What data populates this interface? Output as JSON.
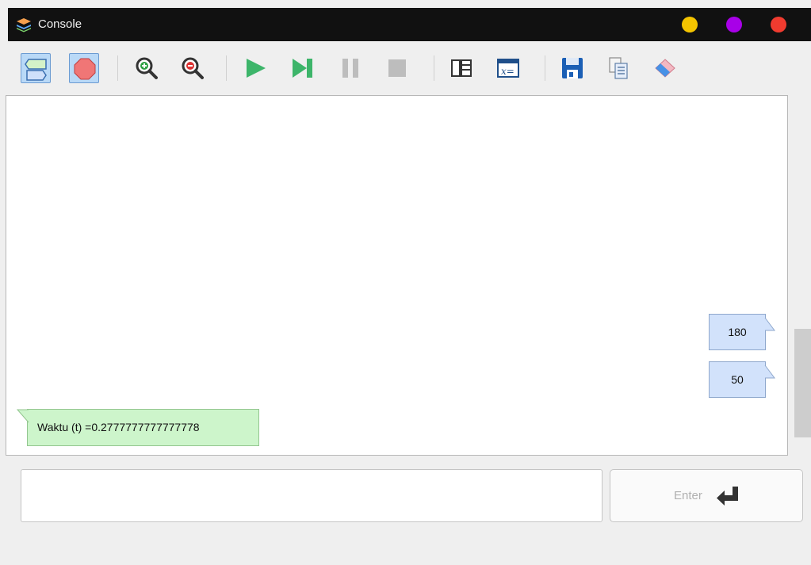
{
  "window": {
    "title": "Console",
    "controls": [
      {
        "name": "minimize",
        "color": "#f4c400"
      },
      {
        "name": "maximize",
        "color": "#a800e8"
      },
      {
        "name": "close",
        "color": "#f03b2f"
      }
    ]
  },
  "toolbar": {
    "buttons": [
      {
        "name": "input-mode-icon",
        "active": true
      },
      {
        "name": "stop-sign-icon",
        "active": true
      },
      {
        "name": "zoom-in-icon"
      },
      {
        "name": "zoom-out-icon"
      },
      {
        "name": "run-icon"
      },
      {
        "name": "step-icon"
      },
      {
        "name": "pause-icon"
      },
      {
        "name": "stop-icon"
      },
      {
        "name": "layout-icon"
      },
      {
        "name": "variables-icon",
        "label": "x="
      },
      {
        "name": "save-icon"
      },
      {
        "name": "copy-icon"
      },
      {
        "name": "eraser-icon"
      }
    ]
  },
  "console": {
    "outputs": [
      {
        "type": "input",
        "value": "180"
      },
      {
        "type": "input",
        "value": "50"
      },
      {
        "type": "output",
        "text": "Waktu (t) =0.2777777777777778"
      }
    ]
  },
  "input": {
    "value": "",
    "placeholder": ""
  },
  "enter_button": {
    "label": "Enter",
    "icon": "enter-arrow-icon"
  },
  "colors": {
    "input_bubble": "#d2e2fb",
    "output_bubble": "#cdf5cb",
    "run_green": "#3db56a",
    "titlebar": "#111111"
  }
}
